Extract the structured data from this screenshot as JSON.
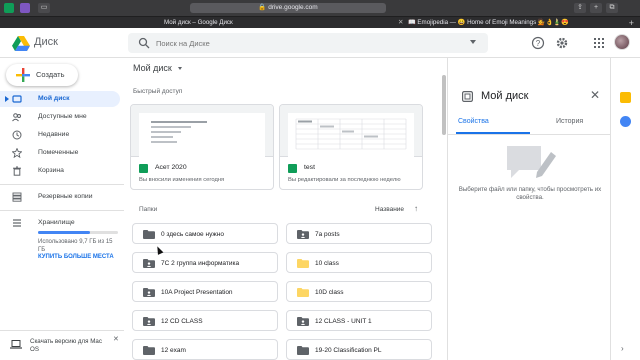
{
  "browser": {
    "address": "drive.google.com",
    "tabs": [
      {
        "title": "Мой диск – Google Диск"
      },
      {
        "title": "📖 Emojipedia — 😀 Home of Emoji Meanings 💁👌🎍😍"
      }
    ]
  },
  "header": {
    "app_name": "Диск",
    "search_placeholder": "Поиск на Диске",
    "icons": [
      "help-icon",
      "settings-icon",
      "apps-grid-icon",
      "avatar"
    ]
  },
  "sidebar": {
    "new_label": "Создать",
    "items": [
      {
        "label": "Мой диск",
        "icon": "drive-icon",
        "active": true
      },
      {
        "label": "Доступные мне",
        "icon": "shared-icon"
      },
      {
        "label": "Недавние",
        "icon": "clock-icon"
      },
      {
        "label": "Помеченные",
        "icon": "star-icon"
      },
      {
        "label": "Корзина",
        "icon": "trash-icon"
      },
      {
        "label": "Резервные копии",
        "icon": "backup-icon"
      },
      {
        "label": "Хранилище",
        "icon": "storage-icon"
      }
    ],
    "storage_used_fraction": 0.65,
    "storage_text": "Использовано 9,7 ГБ из 15 ГБ",
    "buy_more": "КУПИТЬ БОЛЬШЕ МЕСТА",
    "mac_banner": "Скачать версию для Mac OS"
  },
  "main": {
    "title": "Мой диск",
    "quick_access_title": "Быстрый доступ",
    "quick_access": [
      {
        "name": "Асет 2020",
        "subtitle": "Вы вносили изменения сегодня"
      },
      {
        "name": "test",
        "subtitle": "Вы редактировали за последнюю неделю"
      }
    ],
    "folders_title": "Папки",
    "sort_label": "Название",
    "sort_arrow": "↑",
    "folders": [
      {
        "name": "0 здесь самое нужно",
        "shared": false
      },
      {
        "name": "7a posts",
        "shared": true
      },
      {
        "name": "7C 2 группа информатика",
        "shared": true
      },
      {
        "name": "10 class",
        "shared": false,
        "color": "#fdd663"
      },
      {
        "name": "10A Project Presentation",
        "shared": true
      },
      {
        "name": "10D class",
        "shared": false,
        "color": "#fdd663"
      },
      {
        "name": "12 CD CLASS",
        "shared": true
      },
      {
        "name": "12 CLASS - UNIT 1",
        "shared": true
      },
      {
        "name": "12 exam",
        "shared": false
      },
      {
        "name": "19-20 Classification PL",
        "shared": false
      }
    ]
  },
  "details": {
    "title": "Мой диск",
    "tab_properties": "Свойства",
    "tab_history": "История",
    "empty_text": "Выберите файл или папку, чтобы просмотреть их свойства."
  },
  "colors": {
    "accent": "#1a73e8",
    "active_bg": "#e8f0fe",
    "sheets_green": "#0f9d58"
  }
}
